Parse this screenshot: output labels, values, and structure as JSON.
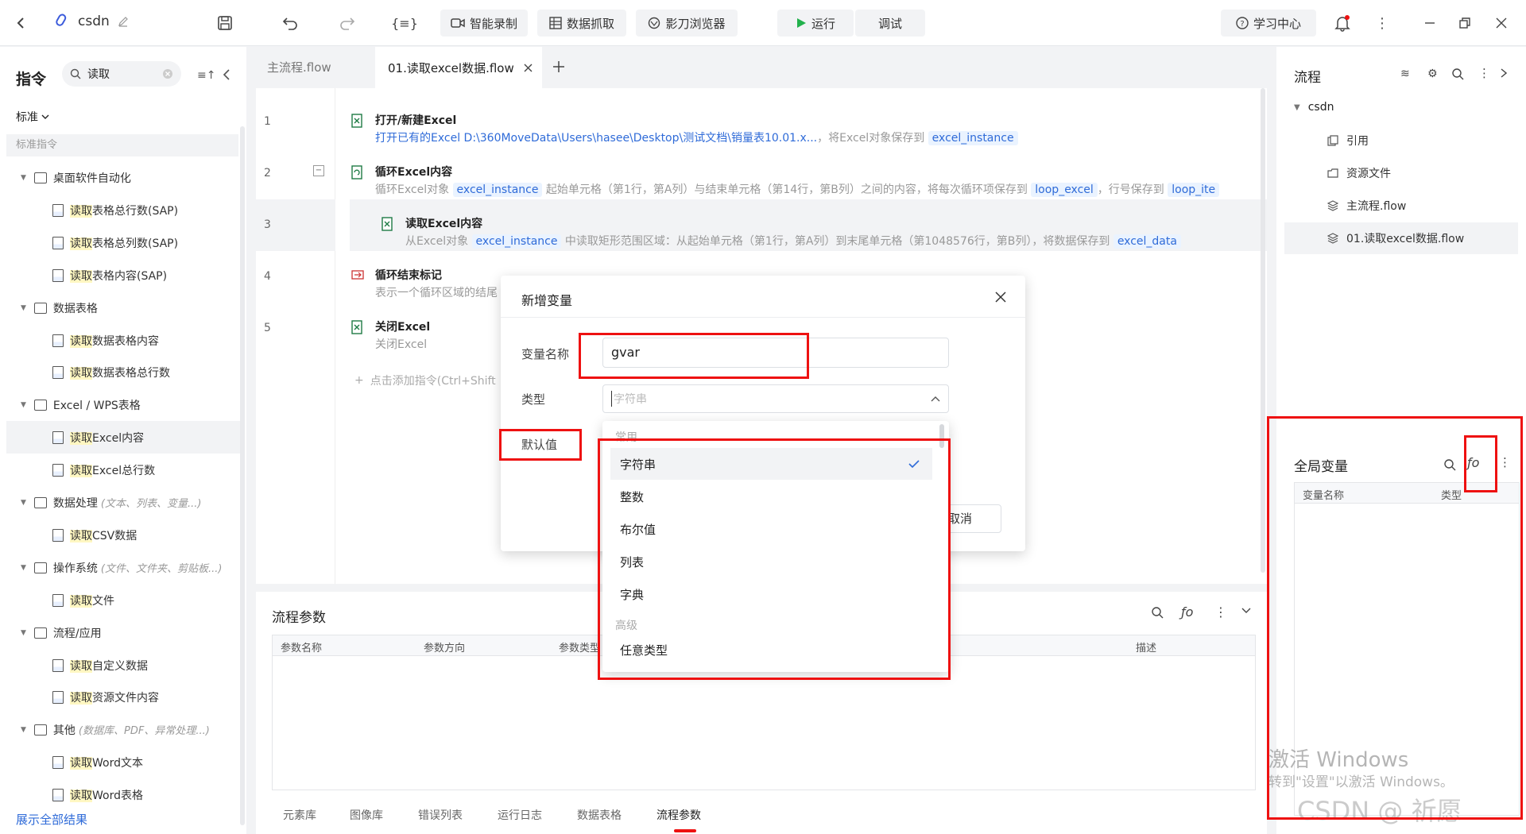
{
  "topbar": {
    "project_name": "csdn",
    "smart_record": "智能录制",
    "data_capture": "数据抓取",
    "browser": "影刀浏览器",
    "run": "运行",
    "debug": "调试",
    "learning_center": "学习中心"
  },
  "left": {
    "title": "指令",
    "search_value": "读取",
    "filter_label": "标准",
    "section_label": "标准指令",
    "show_all": "展示全部结果",
    "groups": [
      {
        "label": "桌面软件自动化",
        "hint": ""
      },
      {
        "label": "数据表格",
        "hint": ""
      },
      {
        "label": "Excel / WPS表格",
        "hint": ""
      },
      {
        "label": "数据处理",
        "hint": "(文本、列表、变量...)"
      },
      {
        "label": "操作系统",
        "hint": "(文件、文件夹、剪贴板...)"
      },
      {
        "label": "流程/应用",
        "hint": ""
      },
      {
        "label": "其他",
        "hint": "(数据库、PDF、异常处理...)"
      }
    ],
    "items": [
      {
        "hl": "读取",
        "rest": "表格总行数(SAP)"
      },
      {
        "hl": "读取",
        "rest": "表格总列数(SAP)"
      },
      {
        "hl": "读取",
        "rest": "表格内容(SAP)"
      },
      {
        "hl": "读取",
        "rest": "数据表格内容"
      },
      {
        "hl": "读取",
        "rest": "数据表格总行数"
      },
      {
        "hl": "读取",
        "rest": "Excel内容"
      },
      {
        "hl": "读取",
        "rest": "Excel总行数"
      },
      {
        "hl": "读取",
        "rest": "CSV数据"
      },
      {
        "hl": "读取",
        "rest": "文件"
      },
      {
        "hl": "读取",
        "rest": "自定义数据"
      },
      {
        "hl": "读取",
        "rest": "资源文件内容"
      },
      {
        "hl": "读取",
        "rest": "Word文本"
      },
      {
        "hl": "读取",
        "rest": "Word表格"
      }
    ]
  },
  "tabs": {
    "main_flow": "主流程.flow",
    "active": "01.读取excel数据.flow"
  },
  "steps": [
    {
      "num": "1",
      "title": "打开/新建Excel",
      "desc": "打开已有的Excel D:\\360MoveData\\Users\\hasee\\Desktop\\测试文档\\销量表10.01.x...",
      "desc2": "，将Excel对象保存到",
      "var1": "excel_instance"
    },
    {
      "num": "2",
      "title": "循环Excel内容",
      "desc": "循环Excel对象",
      "var1": "excel_instance",
      "desc2": "起始单元格（第1行，第A列）与结束单元格（第14行，第B列）之间的内容，将每次循环项保存到",
      "var2": "loop_excel",
      "desc3": "，行号保存到",
      "var3": "loop_ite"
    },
    {
      "num": "3",
      "title": "读取Excel内容",
      "desc": "从Excel对象",
      "var1": "excel_instance",
      "desc2": "中读取矩形范围区域：从起始单元格（第1行，第A列）到末尾单元格（第1048576行，第B列），将数据保存到",
      "var2": "excel_data"
    },
    {
      "num": "4",
      "title": "循环结束标记",
      "desc": "表示一个循环区域的结尾"
    },
    {
      "num": "5",
      "title": "关闭Excel",
      "desc": "关闭Excel"
    }
  ],
  "add_command": "点击添加指令(Ctrl+Shift",
  "params": {
    "title": "流程参数",
    "columns": [
      "参数名称",
      "参数方向",
      "参数类型",
      "描述"
    ]
  },
  "bottom_tabs": [
    "元素库",
    "图像库",
    "错误列表",
    "运行日志",
    "数据表格",
    "流程参数"
  ],
  "right": {
    "title": "流程",
    "project": "csdn",
    "items": [
      "引用",
      "资源文件",
      "主流程.flow",
      "01.读取excel数据.flow"
    ],
    "globals_title": "全局变量",
    "col_name": "变量名称",
    "col_type": "类型"
  },
  "dialog": {
    "title": "新增变量",
    "name_label": "变量名称",
    "name_value": "gvar",
    "type_label": "类型",
    "type_placeholder": "字符串",
    "default_label": "默认值",
    "cancel": "取消"
  },
  "dropdown": {
    "group_common": "常用",
    "options": [
      "字符串",
      "整数",
      "布尔值",
      "列表",
      "字典"
    ],
    "group_advanced": "高级",
    "advanced_options": [
      "任意类型"
    ],
    "selected": "字符串"
  },
  "watermark": {
    "line1": "激活 Windows",
    "line2": "转到\"设置\"以激活 Windows。",
    "csdn": "CSDN @ 祈愿"
  },
  "colors": {
    "accent": "#2f6bd8",
    "highlight": "#fff7c2",
    "annotation": "#ee1111"
  }
}
